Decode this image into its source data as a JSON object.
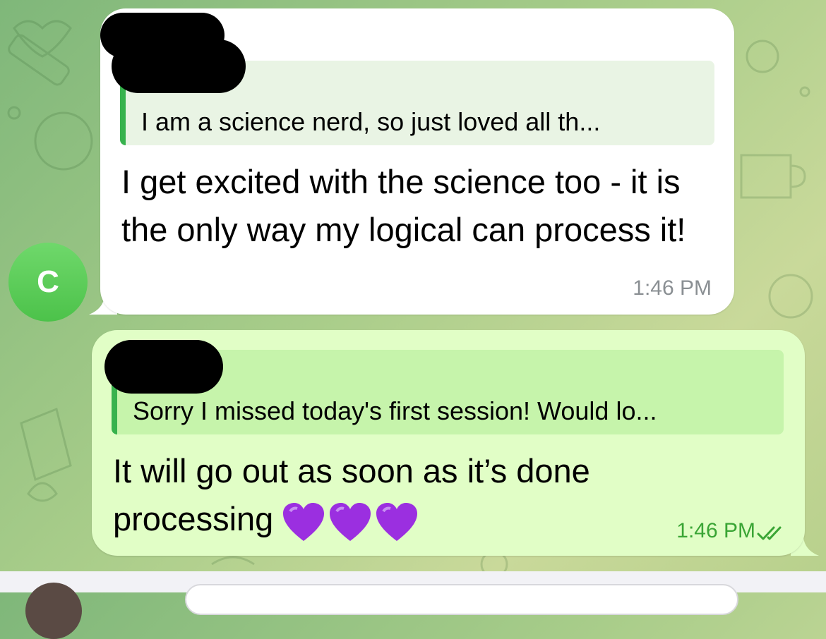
{
  "chat": {
    "incoming": {
      "sender_initial": "C",
      "reply_quote": "I am a science nerd, so just loved all th...",
      "text": "I get excited with the science too - it is the only way my logical can process it!",
      "time": "1:46 PM"
    },
    "outgoing": {
      "reply_quote": "Sorry I missed today's first session! Would lo...",
      "text": "It will go out as soon as it’s done processing",
      "emoji_count": 3,
      "time": "1:46 PM",
      "status": "read"
    }
  },
  "colors": {
    "outgoing_bubble": "#e1fec6",
    "incoming_bubble": "#ffffff",
    "accent_green": "#37b24d",
    "time_green": "#3aa535",
    "avatar_green": "#4cc24a",
    "heart_purple": "#9b2fe0"
  },
  "icons": {
    "emoji": "purple-heart",
    "status": "double-check-icon"
  }
}
